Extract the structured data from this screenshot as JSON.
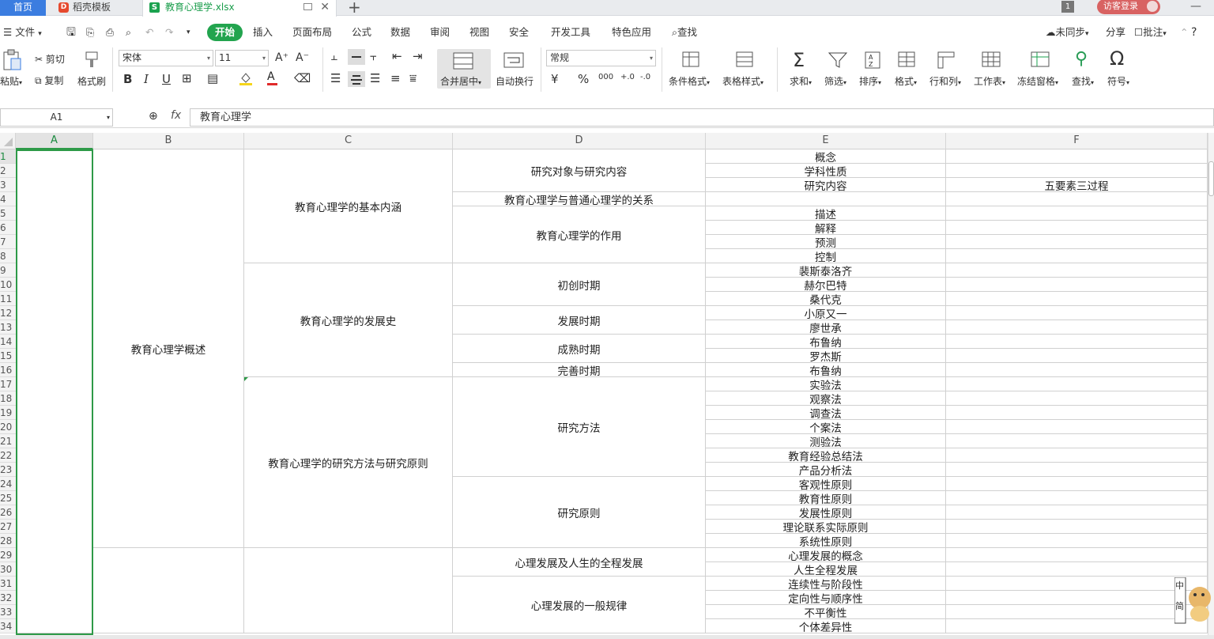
{
  "tabs": {
    "home": "首页",
    "template": "稻壳模板",
    "file": "教育心理学.xlsx",
    "file_icon": "S",
    "template_icon": "D",
    "add": "+",
    "badge": "1",
    "login": "访客登录",
    "minimize": "—",
    "close": "✕"
  },
  "menu": {
    "file": "文件",
    "items": [
      "开始",
      "插入",
      "页面布局",
      "公式",
      "数据",
      "审阅",
      "视图",
      "安全",
      "开发工具",
      "特色应用"
    ],
    "search": "查找",
    "sync": "未同步",
    "share": "分享",
    "comment": "批注",
    "help": "?"
  },
  "ribbon": {
    "paste": "粘贴",
    "cut": "剪切",
    "copy": "复制",
    "format_painter": "格式刷",
    "font_name": "宋体",
    "font_size": "11",
    "bold": "B",
    "italic": "I",
    "underline": "U",
    "font_grow": "A⁺",
    "font_shrink": "A⁻",
    "merge_center": "合并居中",
    "auto_wrap": "自动换行",
    "number_format": "常规",
    "percent": "%",
    "thousands": "000",
    "inc_decimal": "+.0",
    "dec_decimal": "-.0",
    "cond_format": "条件格式",
    "table_style": "表格样式",
    "sum": "求和",
    "filter": "筛选",
    "sort": "排序",
    "format": "格式",
    "row_col": "行和列",
    "worksheet": "工作表",
    "freeze": "冻结窗格",
    "find": "查找",
    "symbol": "符号"
  },
  "formula_bar": {
    "name_box": "A1",
    "fx": "fx",
    "content": "教育心理学"
  },
  "columns": [
    "A",
    "B",
    "C",
    "D",
    "E",
    "F"
  ],
  "rows": [
    "1",
    "2",
    "3",
    "4",
    "5",
    "6",
    "7",
    "8",
    "9",
    "10",
    "11",
    "12",
    "13",
    "14",
    "15",
    "16",
    "17",
    "18",
    "19",
    "20",
    "21",
    "22",
    "23",
    "24",
    "25",
    "26",
    "27",
    "28",
    "29",
    "30",
    "31",
    "32",
    "33",
    "34"
  ],
  "sheet": {
    "b_merged": "教育心理学概述",
    "c_groups": [
      "教育心理学的基本内涵",
      "教育心理学的发展史",
      "教育心理学的研究方法与研究原则"
    ],
    "d_groups": [
      "研究对象与研究内容",
      "教育心理学与普通心理学的关系",
      "教育心理学的作用",
      "初创时期",
      "发展时期",
      "成熟时期",
      "完善时期",
      "研究方法",
      "研究原则",
      "心理发展及人生的全程发展",
      "心理发展的一般规律"
    ],
    "e_values": [
      "概念",
      "学科性质",
      "研究内容",
      "",
      "描述",
      "解释",
      "预测",
      "控制",
      "裴斯泰洛齐",
      "赫尔巴特",
      "桑代克",
      "小原又一",
      "廖世承",
      "布鲁纳",
      "罗杰斯",
      "布鲁纳",
      "实验法",
      "观察法",
      "调查法",
      "个案法",
      "测验法",
      "教育经验总结法",
      "产品分析法",
      "客观性原则",
      "教育性原则",
      "发展性原则",
      "理论联系实际原则",
      "系统性原则",
      "心理发展的概念",
      "人生全程发展",
      "连续性与阶段性",
      "定向性与顺序性",
      "不平衡性",
      "个体差异性"
    ],
    "f3": "五要素三过程"
  },
  "ime": {
    "line1": "中",
    "line2": "简"
  },
  "colors": {
    "accent_green": "#22a44e",
    "tab_blue": "#3b7de0",
    "login_red": "#d86262",
    "selection": "#2e9a48"
  }
}
